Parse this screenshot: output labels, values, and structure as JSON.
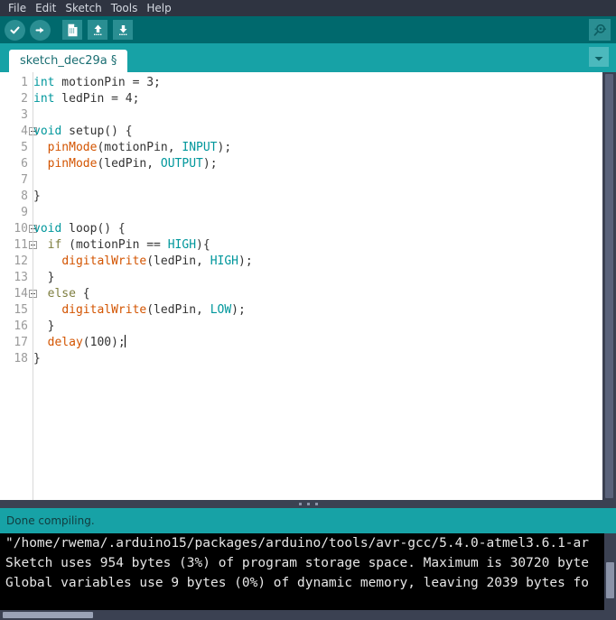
{
  "menubar": {
    "items": [
      {
        "label": "File",
        "name": "menu-file"
      },
      {
        "label": "Edit",
        "name": "menu-edit"
      },
      {
        "label": "Sketch",
        "name": "menu-sketch"
      },
      {
        "label": "Tools",
        "name": "menu-tools"
      },
      {
        "label": "Help",
        "name": "menu-help"
      }
    ]
  },
  "toolbar": {
    "verify_icon": "checkmark-icon",
    "upload_icon": "arrow-right-icon",
    "new_icon": "new-file-icon",
    "open_icon": "open-arrow-up-icon",
    "save_icon": "save-arrow-down-icon",
    "serial_monitor_icon": "magnifier-icon",
    "background": "#00696d"
  },
  "tabbar": {
    "tabs": [
      {
        "label": "sketch_dec29a §",
        "active": true
      }
    ],
    "menu_icon": "chevron-down-icon",
    "background": "#17a2a6"
  },
  "editor": {
    "line_numbers": [
      "1",
      "2",
      "3",
      "4",
      "5",
      "6",
      "7",
      "8",
      "9",
      "10",
      "11",
      "12",
      "13",
      "14",
      "15",
      "16",
      "17",
      "18"
    ],
    "fold_lines": [
      4,
      10,
      11,
      14
    ],
    "cursor_line": 17,
    "lines": [
      {
        "n": "1",
        "tokens": [
          {
            "t": "int",
            "c": "kw"
          },
          {
            "t": " motionPin = 3;",
            "c": "plain"
          }
        ]
      },
      {
        "n": "2",
        "tokens": [
          {
            "t": "int",
            "c": "kw"
          },
          {
            "t": " ledPin = 4;",
            "c": "plain"
          }
        ]
      },
      {
        "n": "3",
        "tokens": []
      },
      {
        "n": "4",
        "tokens": [
          {
            "t": "void",
            "c": "kw"
          },
          {
            "t": " setup() {",
            "c": "plain"
          }
        ]
      },
      {
        "n": "5",
        "tokens": [
          {
            "t": "  ",
            "c": "plain"
          },
          {
            "t": "pinMode",
            "c": "fn"
          },
          {
            "t": "(motionPin, ",
            "c": "plain"
          },
          {
            "t": "INPUT",
            "c": "kw"
          },
          {
            "t": ");",
            "c": "plain"
          }
        ]
      },
      {
        "n": "6",
        "tokens": [
          {
            "t": "  ",
            "c": "plain"
          },
          {
            "t": "pinMode",
            "c": "fn"
          },
          {
            "t": "(ledPin, ",
            "c": "plain"
          },
          {
            "t": "OUTPUT",
            "c": "kw"
          },
          {
            "t": ");",
            "c": "plain"
          }
        ]
      },
      {
        "n": "7",
        "tokens": []
      },
      {
        "n": "8",
        "tokens": [
          {
            "t": "}",
            "c": "plain"
          }
        ]
      },
      {
        "n": "9",
        "tokens": []
      },
      {
        "n": "10",
        "tokens": [
          {
            "t": "void",
            "c": "kw"
          },
          {
            "t": " loop() {",
            "c": "plain"
          }
        ]
      },
      {
        "n": "11",
        "tokens": [
          {
            "t": "  ",
            "c": "plain"
          },
          {
            "t": "if",
            "c": "ctrl"
          },
          {
            "t": " (motionPin == ",
            "c": "plain"
          },
          {
            "t": "HIGH",
            "c": "kw"
          },
          {
            "t": "){",
            "c": "plain"
          }
        ]
      },
      {
        "n": "12",
        "tokens": [
          {
            "t": "    ",
            "c": "plain"
          },
          {
            "t": "digitalWrite",
            "c": "fn"
          },
          {
            "t": "(ledPin, ",
            "c": "plain"
          },
          {
            "t": "HIGH",
            "c": "kw"
          },
          {
            "t": ");",
            "c": "plain"
          }
        ]
      },
      {
        "n": "13",
        "tokens": [
          {
            "t": "  }",
            "c": "plain"
          }
        ]
      },
      {
        "n": "14",
        "tokens": [
          {
            "t": "  ",
            "c": "plain"
          },
          {
            "t": "else",
            "c": "ctrl"
          },
          {
            "t": " {",
            "c": "plain"
          }
        ]
      },
      {
        "n": "15",
        "tokens": [
          {
            "t": "    ",
            "c": "plain"
          },
          {
            "t": "digitalWrite",
            "c": "fn"
          },
          {
            "t": "(ledPin, ",
            "c": "plain"
          },
          {
            "t": "LOW",
            "c": "kw"
          },
          {
            "t": ");",
            "c": "plain"
          }
        ]
      },
      {
        "n": "16",
        "tokens": [
          {
            "t": "  }",
            "c": "plain"
          }
        ]
      },
      {
        "n": "17",
        "tokens": [
          {
            "t": "  ",
            "c": "plain"
          },
          {
            "t": "delay",
            "c": "fn"
          },
          {
            "t": "(100);",
            "c": "plain"
          }
        ]
      },
      {
        "n": "18",
        "tokens": [
          {
            "t": "}",
            "c": "plain"
          }
        ]
      }
    ],
    "colors": {
      "keyword": "#00979c",
      "function": "#d35400",
      "control": "#7e7e3f",
      "plain": "#333333",
      "background": "#ffffff"
    }
  },
  "statusbar": {
    "message": "Done compiling.",
    "background": "#17a2a6"
  },
  "console": {
    "lines": [
      "\"/home/rwema/.arduino15/packages/arduino/tools/avr-gcc/5.4.0-atmel3.6.1-ar",
      "Sketch uses 954 bytes (3%) of program storage space. Maximum is 30720 byte",
      "Global variables use 9 bytes (0%) of dynamic memory, leaving 2039 bytes fo"
    ],
    "background": "#000000"
  }
}
